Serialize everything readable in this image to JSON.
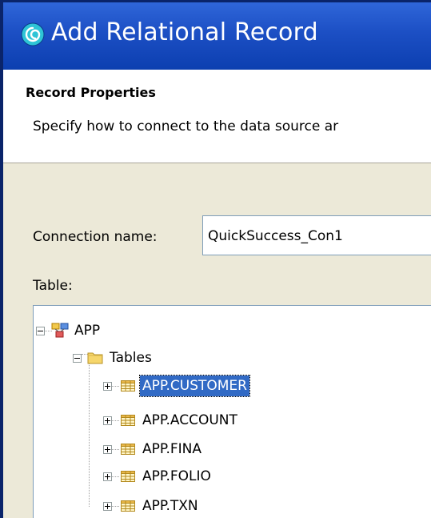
{
  "window": {
    "title": "Add Relational Record",
    "icon": "app-swirl-icon"
  },
  "header": {
    "title": "Record Properties",
    "description": "Specify how to connect to the data source ar"
  },
  "form": {
    "connection_label": "Connection name:",
    "connection_value": "QuickSuccess_Con1",
    "table_label": "Table:"
  },
  "tree": {
    "root": {
      "label": "APP",
      "icon": "database-schema-icon",
      "expanded": true
    },
    "folder": {
      "label": "Tables",
      "icon": "folder-icon",
      "expanded": true
    },
    "items": [
      {
        "label": "APP.CUSTOMER",
        "selected": true
      },
      {
        "label": "APP.ACCOUNT",
        "selected": false
      },
      {
        "label": "APP.FINA",
        "selected": false
      },
      {
        "label": "APP.FOLIO",
        "selected": false
      },
      {
        "label": "APP.TXN",
        "selected": false
      }
    ]
  },
  "colors": {
    "title_bar": "#0c3fb0",
    "selection": "#316ac5",
    "dialog_bg": "#ece9d8"
  }
}
